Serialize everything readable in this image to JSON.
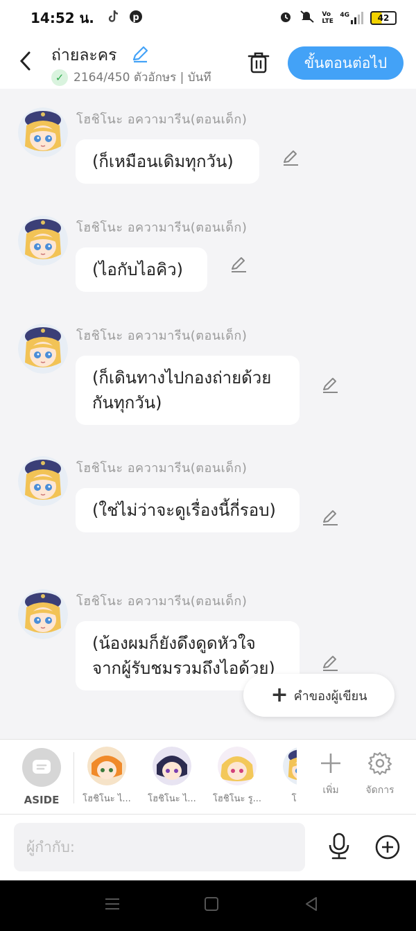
{
  "status_bar": {
    "time": "14:52 น.",
    "battery": "42",
    "network": "4G",
    "volte": "Vo LTE"
  },
  "header": {
    "title": "ถ่ายละคร",
    "char_count": "2164/450 ตัวอักษร | บันทึ",
    "next_button": "ขั้นตอนต่อไป"
  },
  "messages": [
    {
      "speaker": "โฮชิโนะ อความารีน(ตอนเด็ก)",
      "text": "(ก็เหมือนเดิมทุกวัน)"
    },
    {
      "speaker": "โฮชิโนะ อความารีน(ตอนเด็ก)",
      "text": "(ไอกับไอคิว)"
    },
    {
      "speaker": "โฮชิโนะ อความารีน(ตอนเด็ก)",
      "text": "(ก็เดินทางไปกองถ่ายด้วยกันทุกวัน)"
    },
    {
      "speaker": "โฮชิโนะ อความารีน(ตอนเด็ก)",
      "text": "(ใช่ไม่ว่าจะดูเรื่องนี้กี่รอบ)"
    },
    {
      "speaker": "โฮชิโนะ อความารีน(ตอนเด็ก)",
      "text": "(น้องผมก็ยังดึงดูดหัวใจจากผู้รับชมรวมถึงไอด้วย)"
    }
  ],
  "author_note_button": "คำของผู้เขียน",
  "character_bar": {
    "aside_label": "ASIDE",
    "characters": [
      {
        "name": "โฮชิโนะ ไ..."
      },
      {
        "name": "โฮชิโนะ ไ..."
      },
      {
        "name": "โฮชิโนะ รู..."
      },
      {
        "name": "โฮชิโ"
      }
    ],
    "add_label": "เพิ่ม",
    "manage_label": "จัดการ"
  },
  "input": {
    "placeholder": "ผู้กำกับ:"
  },
  "colors": {
    "accent": "#43a2f7",
    "background": "#f4f4f6",
    "bubble": "#ffffff",
    "speaker_text": "#9a9a9a"
  }
}
